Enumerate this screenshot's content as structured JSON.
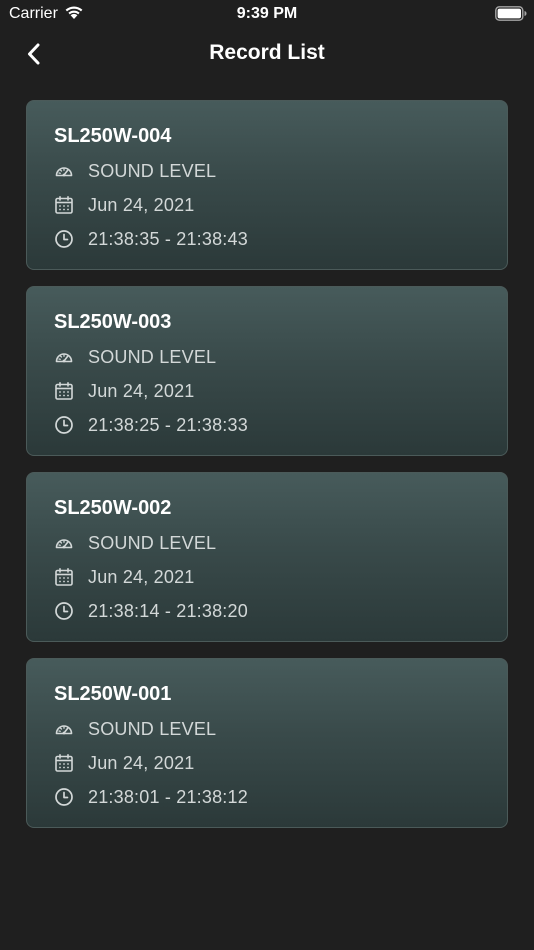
{
  "status_bar": {
    "carrier": "Carrier",
    "time": "9:39 PM"
  },
  "nav": {
    "title": "Record List",
    "back_icon": "chevron-left-icon"
  },
  "colors": {
    "background": "#1f1f1f",
    "card_top": "#475b5b",
    "card_bottom": "#2b3939",
    "text_primary": "#ffffff",
    "text_secondary": "#d3d8d8"
  },
  "records": [
    {
      "name": "SL250W-004",
      "type": "SOUND LEVEL",
      "date": "Jun 24, 2021",
      "time_range": "21:38:35 - 21:38:43"
    },
    {
      "name": "SL250W-003",
      "type": "SOUND LEVEL",
      "date": "Jun 24, 2021",
      "time_range": "21:38:25 - 21:38:33"
    },
    {
      "name": "SL250W-002",
      "type": "SOUND LEVEL",
      "date": "Jun 24, 2021",
      "time_range": "21:38:14 - 21:38:20"
    },
    {
      "name": "SL250W-001",
      "type": "SOUND LEVEL",
      "date": "Jun 24, 2021",
      "time_range": "21:38:01 - 21:38:12"
    }
  ]
}
